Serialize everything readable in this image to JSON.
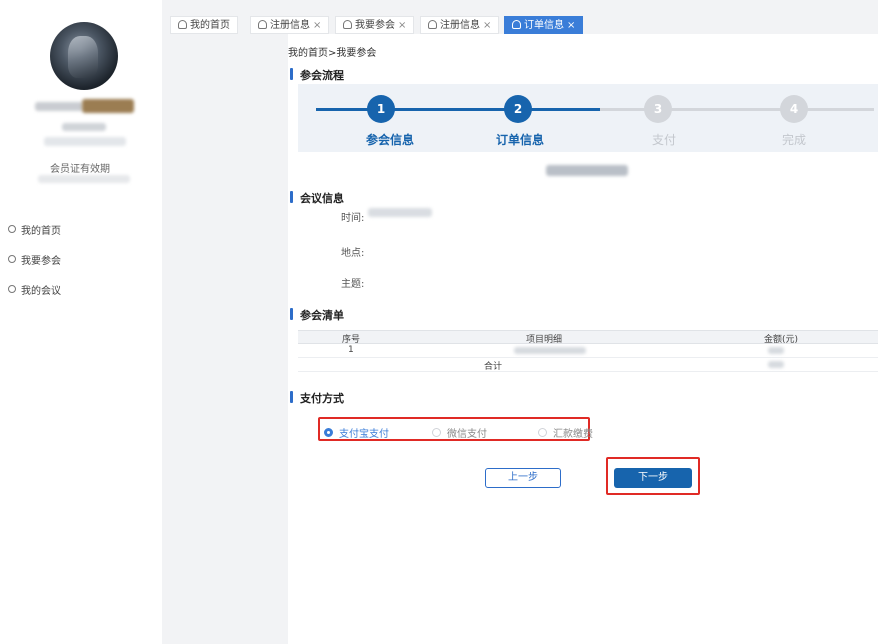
{
  "tabs": [
    {
      "label": "我的首页",
      "closable": false,
      "active": false
    },
    {
      "label": "注册信息",
      "closable": true,
      "active": false
    },
    {
      "label": "我要参会",
      "closable": true,
      "active": false
    },
    {
      "label": "注册信息",
      "closable": true,
      "active": false
    },
    {
      "label": "订单信息",
      "closable": true,
      "active": true
    }
  ],
  "close_glyph": "×",
  "profile": {
    "membership_valid_label": "会员证有效期"
  },
  "sidebar": {
    "items": [
      {
        "label": "我的首页"
      },
      {
        "label": "我要参会"
      },
      {
        "label": "我的会议"
      }
    ]
  },
  "breadcrumb": "我的首页>我要参会",
  "process": {
    "title": "参会流程",
    "steps": [
      {
        "number": "1",
        "label": "参会信息",
        "state": "done"
      },
      {
        "number": "2",
        "label": "订单信息",
        "state": "current"
      },
      {
        "number": "3",
        "label": "支付",
        "state": "pending"
      },
      {
        "number": "4",
        "label": "完成",
        "state": "pending"
      }
    ]
  },
  "meeting": {
    "title": "会议信息",
    "time_label": "时间:",
    "place_label": "地点:",
    "topic_label": "主题:"
  },
  "list": {
    "title": "参会清单",
    "headers": {
      "seq": "序号",
      "item": "项目明细",
      "amount": "金额(元)"
    },
    "rows": [
      {
        "seq": "1"
      }
    ],
    "total_label": "合计"
  },
  "payment": {
    "title": "支付方式",
    "options": [
      {
        "label": "支付宝支付",
        "selected": true
      },
      {
        "label": "微信支付",
        "selected": false
      },
      {
        "label": "汇款缴费",
        "selected": false
      }
    ]
  },
  "buttons": {
    "prev": "上一步",
    "next": "下一步"
  },
  "colors": {
    "primary": "#1764ad",
    "tab_active": "#3a7dd8",
    "highlight_box": "#e02a25"
  }
}
